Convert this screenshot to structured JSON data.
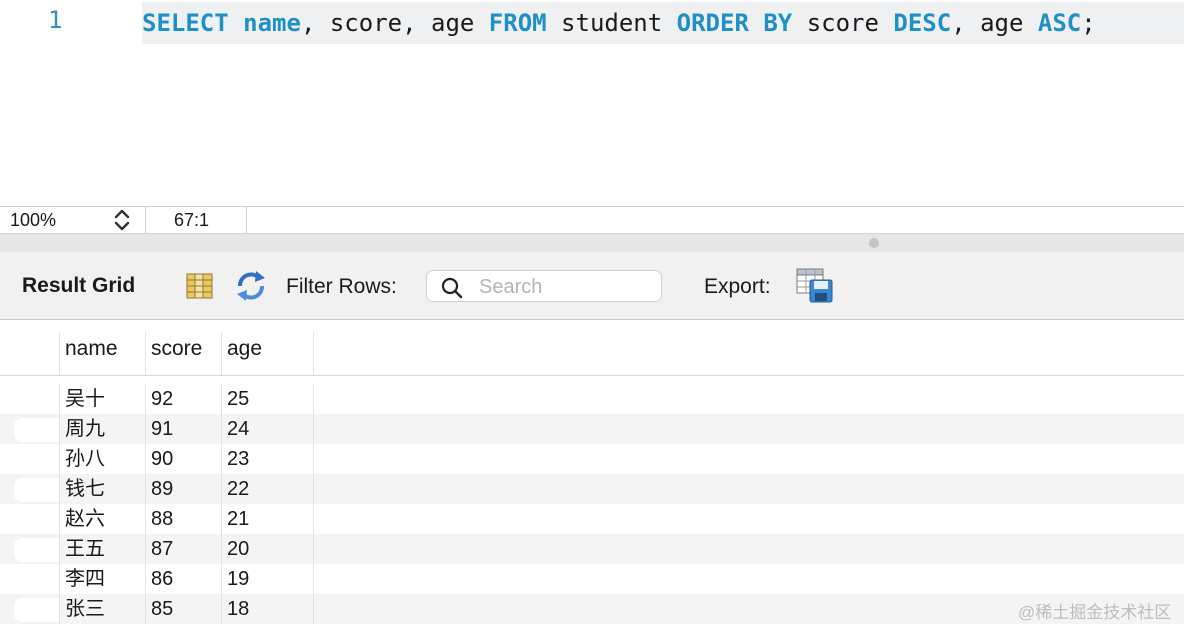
{
  "editor": {
    "line_number": "1",
    "sql_tokens": [
      {
        "text": "SELECT",
        "type": "kw"
      },
      {
        "text": " ",
        "type": "pn"
      },
      {
        "text": "name",
        "type": "kw"
      },
      {
        "text": ", score, age ",
        "type": "id"
      },
      {
        "text": "FROM",
        "type": "kw"
      },
      {
        "text": " student ",
        "type": "id"
      },
      {
        "text": "ORDER",
        "type": "kw"
      },
      {
        "text": " ",
        "type": "pn"
      },
      {
        "text": "BY",
        "type": "kw"
      },
      {
        "text": " score ",
        "type": "id"
      },
      {
        "text": "DESC",
        "type": "kw"
      },
      {
        "text": ", age ",
        "type": "id"
      },
      {
        "text": "ASC",
        "type": "kw"
      },
      {
        "text": ";",
        "type": "pn"
      }
    ]
  },
  "status": {
    "zoom": "100%",
    "cursor_position": "67:1"
  },
  "result_toolbar": {
    "title": "Result Grid",
    "filter_label": "Filter Rows:",
    "search_placeholder": "Search",
    "search_value": "",
    "export_label": "Export:"
  },
  "grid": {
    "columns": [
      "name",
      "score",
      "age"
    ],
    "rows": [
      {
        "name": "吴十",
        "score": "92",
        "age": "25"
      },
      {
        "name": "周九",
        "score": "91",
        "age": "24"
      },
      {
        "name": "孙八",
        "score": "90",
        "age": "23"
      },
      {
        "name": "钱七",
        "score": "89",
        "age": "22"
      },
      {
        "name": "赵六",
        "score": "88",
        "age": "21"
      },
      {
        "name": "王五",
        "score": "87",
        "age": "20"
      },
      {
        "name": "李四",
        "score": "86",
        "age": "19"
      },
      {
        "name": "张三",
        "score": "85",
        "age": "18"
      }
    ]
  },
  "watermark": "@稀土掘金技术社区",
  "colors": {
    "keyword": "#1f8fc7",
    "line_number": "#2f8fbf"
  },
  "icons": {
    "zoom_stepper": "updown-chevron-icon",
    "grid_view": "grid-columns-icon",
    "refresh": "refresh-arrows-icon",
    "search": "search-icon",
    "export": "export-table-disk-icon"
  }
}
